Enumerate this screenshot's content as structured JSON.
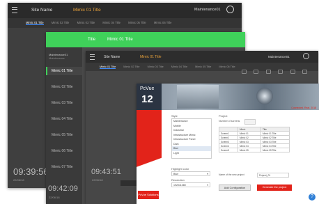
{
  "win1": {
    "site": "Site Name",
    "title": "Mimic 01 Title",
    "user": "Maintenance01",
    "tabs": [
      "Mimic 01 Title",
      "Mimic 02 Title",
      "Mimic 03 Title",
      "Mimic 04 Title",
      "Mimic 05 Title",
      "Mimic 06 Title"
    ],
    "time": "09:39:56",
    "date": "22/06/18"
  },
  "win2": {
    "title": "Title",
    "mimic": "Mimic 01 Title",
    "user": "Maintenance01",
    "role": "Maintenance",
    "menu": [
      "Mimic 01 Title",
      "Mimic 02 Title",
      "Mimic 03 Title",
      "Mimic 04 Title",
      "Mimic 05 Title",
      "Mimic 06 Title",
      "Mimic 07 Title"
    ],
    "time": "09:42:09",
    "date": "22/06/18"
  },
  "win3": {
    "site": "Site Name",
    "title": "Mimic 01 Title",
    "user": "Maintenance01",
    "tabs": [
      "Mimic 01 Title",
      "Mimic 02 Title",
      "Mimic 03 Title",
      "Mimic 04 Title",
      "Mimic 05 Title",
      "Mimic 06 Title"
    ],
    "time": "09:43:51",
    "date": "22/06/18"
  },
  "dialog": {
    "brand": "PcVue",
    "version": "12",
    "tagline": "Connected. Real. 2018",
    "style_label": "Style",
    "styles": [
      "Maintenance",
      "Mobile",
      "Industrial",
      "Infrastructure Mimic",
      "Infrastructure Panel",
      "Dark",
      "Blue",
      "Light"
    ],
    "project_label": "Project",
    "screens_label": "Number of screens",
    "table_headers": [
      "",
      "Mimic",
      "Title"
    ],
    "table_rows": [
      [
        "Screen1",
        "Mimic 01",
        "Mimic 01 Title"
      ],
      [
        "Screen2",
        "Mimic 02",
        "Mimic 02 Title"
      ],
      [
        "Screen3",
        "Mimic 03",
        "Mimic 03 Title"
      ],
      [
        "Screen4",
        "Mimic 04",
        "Mimic 04 Title"
      ],
      [
        "Screen5",
        "Mimic 05",
        "Mimic 05 Title"
      ]
    ],
    "highlight_label": "Highlight color",
    "highlight_value": "Blue",
    "resolution_label": "Resolution",
    "resolution_value": "1920x1080",
    "name_label": "Name of the new project",
    "name_value": "Project_01",
    "logo_text": "PcVue Solutions",
    "add_button": "Add Configuration",
    "generate_button": "Generate the project"
  },
  "colors": {
    "dark_bg": "#3f3f3f",
    "dark_bar": "#2a2a2a",
    "accent_orange": "#e9a23b",
    "green": "#3fd15a",
    "red": "#e2231a",
    "blue_tab": "#3d8bff"
  }
}
